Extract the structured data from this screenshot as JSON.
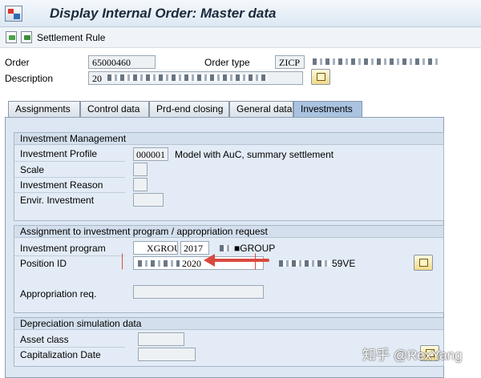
{
  "window": {
    "title": "Display Internal Order: Master data"
  },
  "toolbar": {
    "settlement_rule_label": "Settlement Rule"
  },
  "header": {
    "order_label": "Order",
    "order_value": "65000460",
    "order_type_label": "Order type",
    "order_type_value": "ZICP",
    "description_label": "Description",
    "description_value": "20"
  },
  "tabs": [
    {
      "label": "Assignments"
    },
    {
      "label": "Control data"
    },
    {
      "label": "Prd-end closing"
    },
    {
      "label": "General data"
    },
    {
      "label": "Investments",
      "active": true
    }
  ],
  "investment_management": {
    "title": "Investment Management",
    "investment_profile_label": "Investment Profile",
    "investment_profile_value": "000001",
    "investment_profile_text": "Model with AuC, summary settlement",
    "scale_label": "Scale",
    "investment_reason_label": "Investment Reason",
    "envir_investment_label": "Envir. Investment"
  },
  "assignment": {
    "title": "Assignment to investment program / appropriation request",
    "investment_program_label": "Investment program",
    "investment_program_value": "XGROUP",
    "investment_program_year": "2017",
    "investment_program_text": "GROUP",
    "position_id_label": "Position ID",
    "position_id_value": "2020",
    "position_id_text": "59VE",
    "appropriation_req_label": "Appropriation req."
  },
  "depreciation": {
    "title": "Depreciation simulation data",
    "asset_class_label": "Asset class",
    "capitalization_date_label": "Capitalization Date"
  },
  "watermark": "知乎 @RexYang",
  "colors": {
    "accent_tab": "#a9c3e0",
    "annotation_arrow": "#d9493f"
  }
}
